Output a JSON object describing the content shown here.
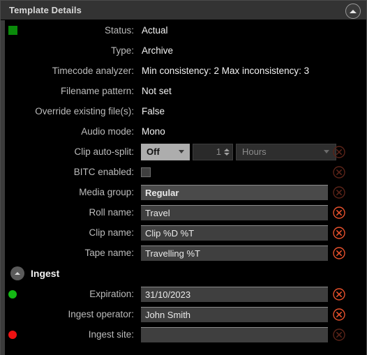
{
  "panel": {
    "title": "Template Details",
    "collapse_icon": "chevron-up-icon"
  },
  "colors": {
    "status_green": "#0a8a0a",
    "dot_green": "#14b814",
    "dot_red": "#ee1111",
    "reset_active": "#e8512c",
    "reset_disabled": "#5a2318",
    "panel_bg": "#000000",
    "titlebar_bg": "#333333",
    "field_bg": "#3f3f3f"
  },
  "rows": [
    {
      "label": "Status:",
      "value": "Actual",
      "indicator": "green-square"
    },
    {
      "label": "Type:",
      "value": "Archive"
    },
    {
      "label": "Timecode analyzer:",
      "value": "Min consistency: 2 Max inconsistency: 3"
    },
    {
      "label": "Filename pattern:",
      "value": "Not set"
    },
    {
      "label": "Override existing file(s):",
      "value": "False"
    },
    {
      "label": "Audio mode:",
      "value": "Mono"
    }
  ],
  "autosplit": {
    "label": "Clip auto-split:",
    "mode": "Off",
    "amount": "1",
    "unit": "Hours",
    "reset_enabled": false
  },
  "bitc": {
    "label": "BITC enabled:",
    "checked": false,
    "reset_enabled": false
  },
  "fields": [
    {
      "label": "Media group:",
      "value": "Regular",
      "bold": true,
      "reset_enabled": false
    },
    {
      "label": "Roll name:",
      "value": "Travel",
      "bold": false,
      "reset_enabled": true
    },
    {
      "label": "Clip name:",
      "value": "Clip %D %T",
      "bold": false,
      "reset_enabled": true
    },
    {
      "label": "Tape name:",
      "value": "Travelling %T",
      "bold": false,
      "reset_enabled": true
    }
  ],
  "ingest": {
    "title": "Ingest",
    "collapse_icon": "chevron-up-icon",
    "fields": [
      {
        "label": "Expiration:",
        "value": "31/10/2023",
        "indicator": "green-dot",
        "reset_enabled": true
      },
      {
        "label": "Ingest operator:",
        "value": "John Smith",
        "indicator": "none",
        "reset_enabled": true
      },
      {
        "label": "Ingest site:",
        "value": "",
        "indicator": "red-dot",
        "reset_enabled": false
      }
    ]
  }
}
